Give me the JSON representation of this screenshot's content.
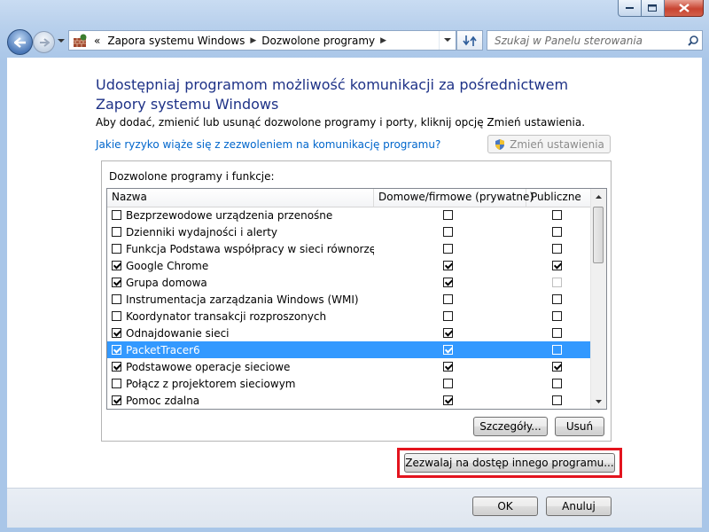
{
  "breadcrumb": {
    "overflow": "«",
    "items": [
      "Zapora systemu Windows",
      "Dozwolone programy"
    ]
  },
  "search": {
    "placeholder": "Szukaj w Panelu sterowania"
  },
  "page": {
    "heading": "Udostępniaj programom możliwość komunikacji za pośrednictwem Zapory systemu Windows",
    "description": "Aby dodać, zmienić lub usunąć dozwolone programy i porty, kliknij opcję Zmień ustawienia.",
    "risk_link": "Jakie ryzyko wiąże się z zezwoleniem na komunikację programu?",
    "change_settings": "Zmień ustawienia"
  },
  "list": {
    "group_label": "Dozwolone programy i funkcje:",
    "columns": [
      "Nazwa",
      "Domowe/firmowe (prywatne)",
      "Publiczne"
    ],
    "rows": [
      {
        "name": "Bezprzewodowe urządzenia przenośne",
        "enabled": false,
        "private": false,
        "public": false,
        "selected": false
      },
      {
        "name": "Dzienniki wydajności i alerty",
        "enabled": false,
        "private": false,
        "public": false,
        "selected": false
      },
      {
        "name": "Funkcja Podstawa współpracy w sieci równorzędne...",
        "enabled": false,
        "private": false,
        "public": false,
        "selected": false
      },
      {
        "name": "Google Chrome",
        "enabled": true,
        "private": true,
        "public": true,
        "selected": false
      },
      {
        "name": "Grupa domowa",
        "enabled": true,
        "private": true,
        "public": false,
        "public_dim": true,
        "selected": false
      },
      {
        "name": "Instrumentacja zarządzania Windows (WMI)",
        "enabled": false,
        "private": false,
        "public": false,
        "selected": false
      },
      {
        "name": "Koordynator transakcji rozproszonych",
        "enabled": false,
        "private": false,
        "public": false,
        "selected": false
      },
      {
        "name": "Odnajdowanie sieci",
        "enabled": true,
        "private": true,
        "public": false,
        "selected": false
      },
      {
        "name": "PacketTracer6",
        "enabled": true,
        "private": true,
        "public": false,
        "selected": true
      },
      {
        "name": "Podstawowe operacje sieciowe",
        "enabled": true,
        "private": true,
        "public": true,
        "selected": false
      },
      {
        "name": "Połącz z projektorem sieciowym",
        "enabled": false,
        "private": false,
        "public": false,
        "selected": false
      },
      {
        "name": "Pomoc zdalna",
        "enabled": true,
        "private": true,
        "public": false,
        "selected": false
      }
    ],
    "details_button": "Szczegóły...",
    "remove_button": "Usuń"
  },
  "allow_other_button": "Zezwalaj na dostęp innego programu...",
  "footer": {
    "ok": "OK",
    "cancel": "Anuluj"
  },
  "colors": {
    "heading": "#1e3287",
    "link": "#0066cc",
    "selection": "#3399ff",
    "highlight_box": "#e3141e"
  }
}
